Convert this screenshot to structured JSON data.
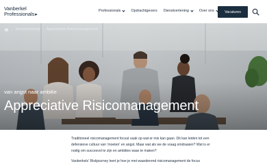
{
  "header": {
    "logo_line1": "Vanberkel",
    "logo_line2": "Professionals",
    "logo_arrow": "▸",
    "nav": [
      {
        "label": "Professionals",
        "dropdown": true
      },
      {
        "label": "Opdrachtgevers",
        "dropdown": false
      },
      {
        "label": "Dienstverlening",
        "dropdown": true
      },
      {
        "label": "Over ons",
        "dropdown": true
      }
    ],
    "cta_label": "Vacatures",
    "search_icon": "magnifier-icon"
  },
  "breadcrumb": {
    "home_icon": "home-icon",
    "items": [
      "Dienstverlening",
      "Appreciative Risicomanagement"
    ]
  },
  "hero": {
    "subtitle": "van angst naar ambitie",
    "title": "Appreciative Risicomanagement"
  },
  "content": {
    "paragraph1": "Traditioneel risicomanagement focust vaak op wat er mis kan gaan. Dit kan leiden tot een defensieve cultuur van 'moeten' en angst. Maar wat als we de vraag omdraaien? Wat is er nodig om succesvol te zijn en ambities waar te maken?",
    "paragraph2": "Vanberkels' Riskjourney leert je hoe je met waarderend risicomanagement de focus"
  },
  "colors": {
    "navy": "#1b2e3f",
    "text": "#1c2a3a",
    "white": "#ffffff"
  }
}
